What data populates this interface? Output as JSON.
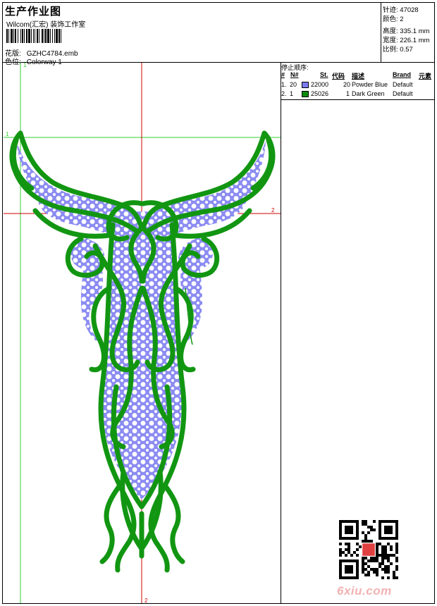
{
  "header": {
    "title": "生产作业图",
    "company": "Wilcom(汇宏) 装饰工作室",
    "design_label": "花版:",
    "design_value": "GZHC4784.emb",
    "colorway_label": "色位:",
    "colorway_value": "Colorway 1"
  },
  "stats": [
    {
      "label": "针迹:",
      "value": "47028"
    },
    {
      "label": "颜色:",
      "value": "2"
    },
    {
      "label": "高度:",
      "value": "335.1 mm"
    },
    {
      "label": "宽度:",
      "value": "226.1 mm"
    },
    {
      "label": "比例:",
      "value": "0.57"
    }
  ],
  "sequence": {
    "title": "停止顺序:",
    "headers": [
      "#",
      "N#",
      "St.",
      "代码",
      "描述",
      "Brand",
      "元素"
    ],
    "rows": [
      {
        "idx": "1.",
        "n": "20",
        "color": "#7b7bf0",
        "code": "22000",
        "st": "20",
        "desc": "Powder Blue",
        "brand": "Default"
      },
      {
        "idx": "2.",
        "n": "1",
        "color": "#0a8a0a",
        "code": "25026",
        "st": "1",
        "desc": "Dark Green",
        "brand": "Default"
      }
    ]
  },
  "markers": {
    "v1": "1",
    "h1": "1",
    "h2": "2",
    "v2": "2"
  },
  "colors": {
    "fill": "#8c8cf2",
    "stitch": "#129612",
    "guide_green": "#33cc33",
    "guide_red": "#cc0000"
  },
  "watermark": {
    "text": "6xiu.com"
  }
}
